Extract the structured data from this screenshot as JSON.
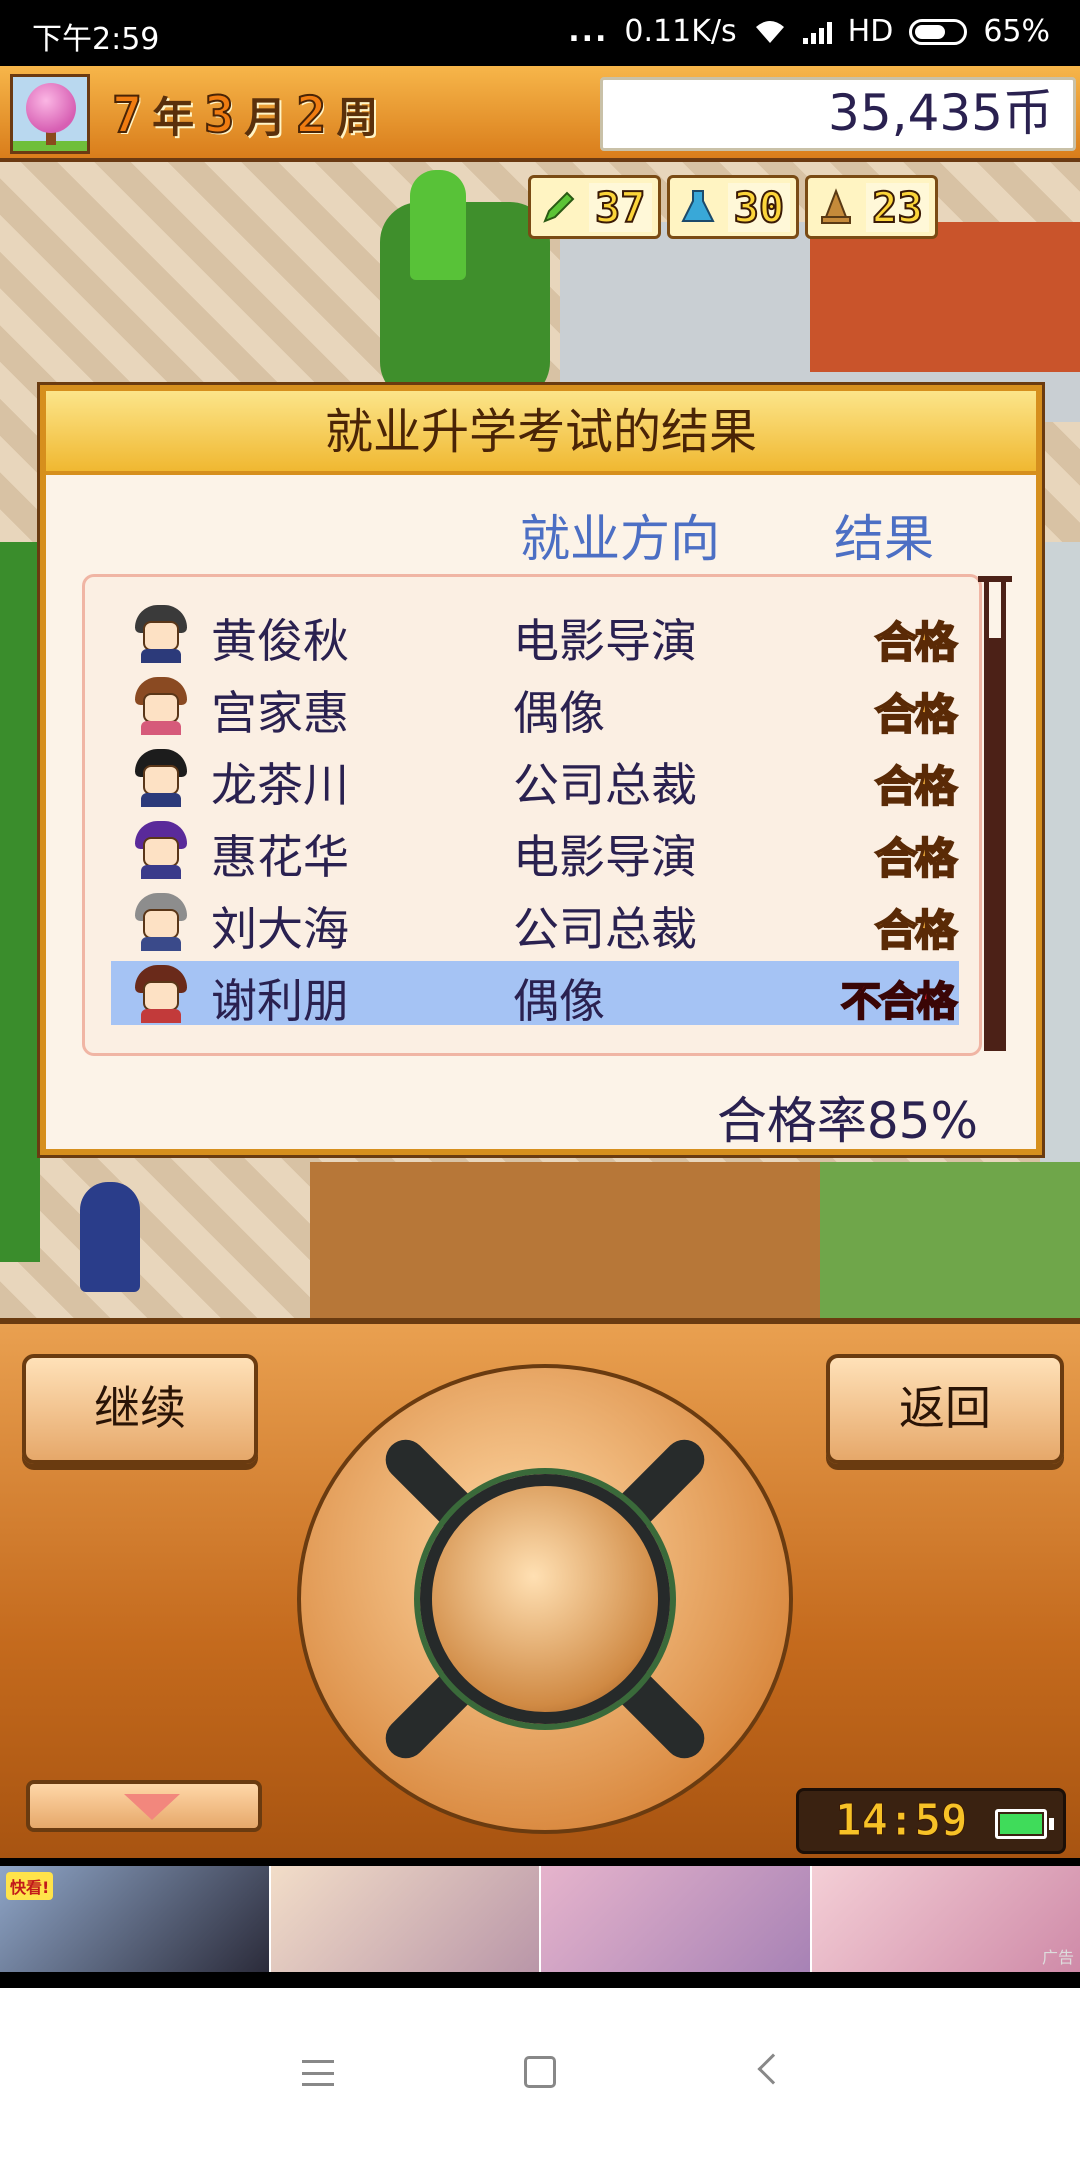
{
  "status_bar": {
    "time": "下午2:59",
    "dots": "...",
    "network_speed": "0.11K/s",
    "hd": "HD",
    "battery": "65%",
    "battery_level": 0.65
  },
  "header": {
    "year": "7",
    "year_unit": "年",
    "month": "3",
    "month_unit": "月",
    "week": "2",
    "week_unit": "周",
    "money": "35,435币"
  },
  "stats": [
    {
      "icon": "pencil-icon",
      "value": "37"
    },
    {
      "icon": "flask-icon",
      "value": "30"
    },
    {
      "icon": "bell-icon",
      "value": "23"
    }
  ],
  "dialog": {
    "title": "就业升学考试的结果",
    "col_job": "就业方向",
    "col_result": "结果",
    "rows": [
      {
        "name": "黄俊秋",
        "job": "电影导演",
        "result": "合格",
        "pass": true
      },
      {
        "name": "宫家惠",
        "job": "偶像",
        "result": "合格",
        "pass": true
      },
      {
        "name": "龙茶川",
        "job": "公司总裁",
        "result": "合格",
        "pass": true
      },
      {
        "name": "惠花华",
        "job": "电影导演",
        "result": "合格",
        "pass": true
      },
      {
        "name": "刘大海",
        "job": "公司总裁",
        "result": "合格",
        "pass": true
      },
      {
        "name": "谢利朋",
        "job": "偶像",
        "result": "不合格",
        "pass": false
      }
    ],
    "pass_rate": "合格率85%"
  },
  "controller": {
    "continue_label": "继续",
    "back_label": "返回",
    "clock": "14:59"
  },
  "ad": {
    "tag": "快看!",
    "label": "广告"
  },
  "colors": {
    "accent_orange": "#d68f1d",
    "header_blue": "#4c6fc4",
    "selected_row": "#a5c3f4",
    "fail_red": "#ee2230"
  }
}
